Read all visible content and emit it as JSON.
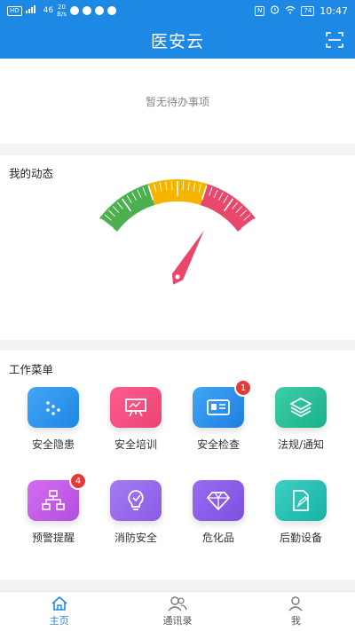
{
  "status_bar": {
    "left_chip": "HD",
    "signal_text": "46",
    "speed_value": "20",
    "speed_unit": "B/s",
    "nfc": "N",
    "battery": "74",
    "time": "10:47"
  },
  "app_bar": {
    "title": "医安云",
    "scan_icon": "scan-icon"
  },
  "todo": {
    "empty_text": "暂无待办事项"
  },
  "dynamics": {
    "title": "我的动态",
    "gauge_value_fraction": 0.78,
    "gauge_colors": [
      "#4caf50",
      "#f5b400",
      "#e8486b"
    ]
  },
  "menu": {
    "title": "工作菜单",
    "items": [
      {
        "label": "安全隐患",
        "icon": "dots-icon",
        "color_a": "#42a5f5",
        "color_b": "#1e88e5",
        "badge": ""
      },
      {
        "label": "安全培训",
        "icon": "board-icon",
        "color_a": "#ff5c8d",
        "color_b": "#e84474",
        "badge": ""
      },
      {
        "label": "安全检查",
        "icon": "id-card-icon",
        "color_a": "#42a5f5",
        "color_b": "#1e7fe0",
        "badge": "1"
      },
      {
        "label": "法规/通知",
        "icon": "layers-icon",
        "color_a": "#3ecfa6",
        "color_b": "#19b08a",
        "badge": ""
      },
      {
        "label": "预警提醒",
        "icon": "flowchart-icon",
        "color_a": "#d56cf0",
        "color_b": "#b24fe0",
        "badge": "4"
      },
      {
        "label": "消防安全",
        "icon": "bulb-icon",
        "color_a": "#a57cf2",
        "color_b": "#8a5ae6",
        "badge": ""
      },
      {
        "label": "危化品",
        "icon": "diamond-icon",
        "color_a": "#9a6cf0",
        "color_b": "#7c4fe2",
        "badge": ""
      },
      {
        "label": "后勤设备",
        "icon": "edit-doc-icon",
        "color_a": "#3ecfc4",
        "color_b": "#16b3a6",
        "badge": ""
      }
    ]
  },
  "tabs": [
    {
      "label": "主页",
      "icon": "home-icon",
      "active": true
    },
    {
      "label": "通讯录",
      "icon": "contacts-icon",
      "active": false
    },
    {
      "label": "我",
      "icon": "person-icon",
      "active": false
    }
  ]
}
